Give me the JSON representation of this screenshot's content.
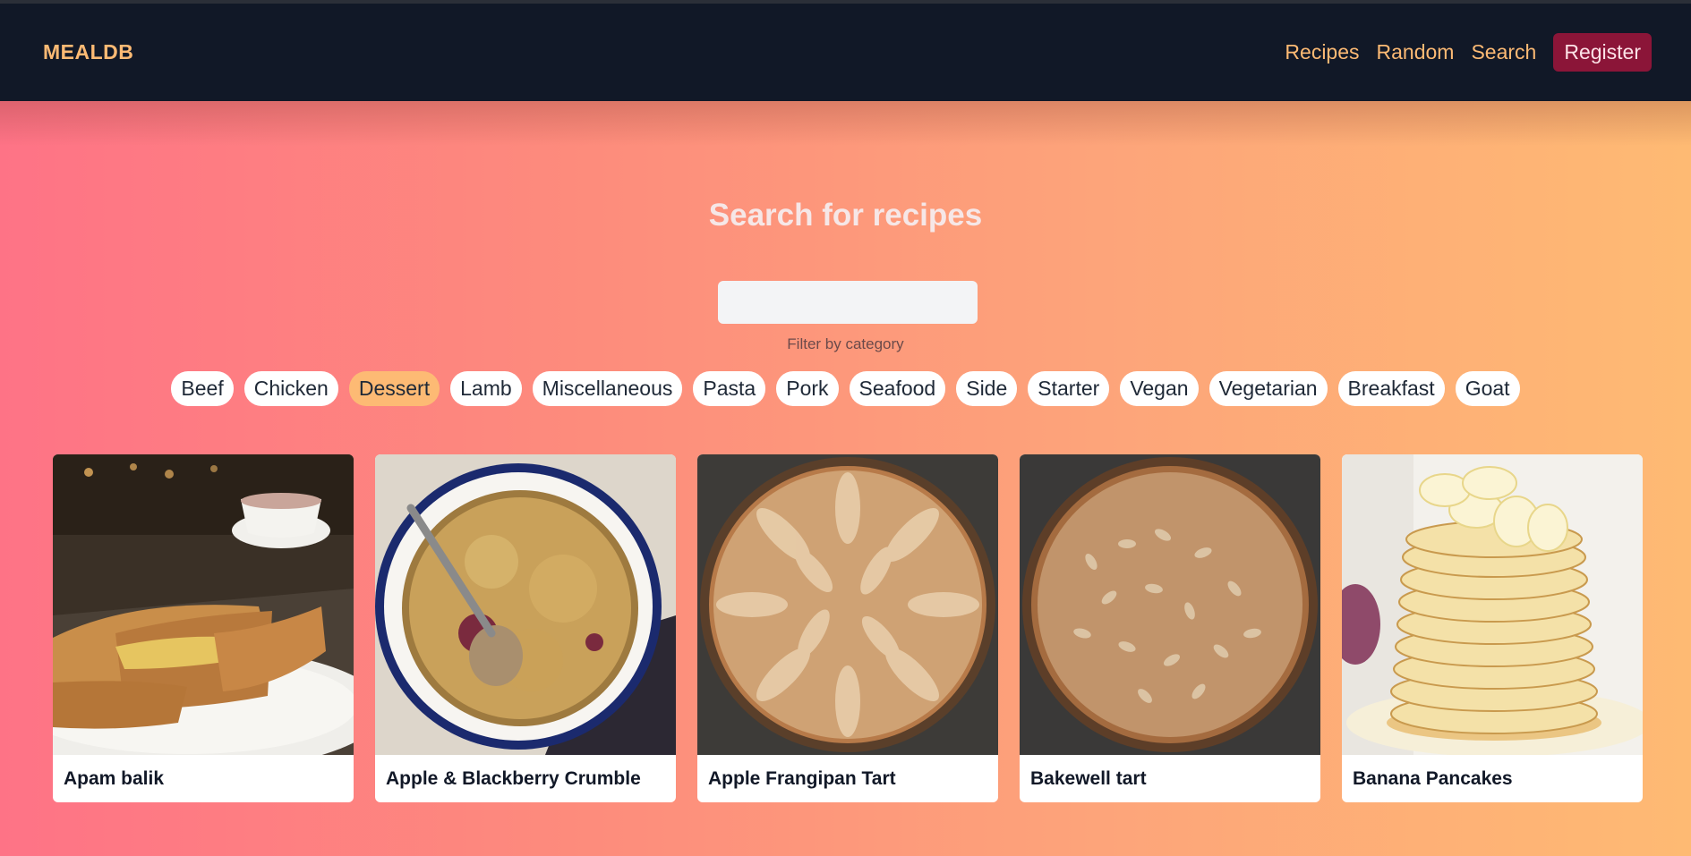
{
  "app": {
    "brand": "MEALDB"
  },
  "nav": {
    "links": [
      "Recipes",
      "Random",
      "Search"
    ],
    "register_label": "Register"
  },
  "search": {
    "title": "Search for recipes",
    "value": "",
    "placeholder": "",
    "filter_label": "Filter by category"
  },
  "categories": {
    "items": [
      "Beef",
      "Chicken",
      "Dessert",
      "Lamb",
      "Miscellaneous",
      "Pasta",
      "Pork",
      "Seafood",
      "Side",
      "Starter",
      "Vegan",
      "Vegetarian",
      "Breakfast",
      "Goat"
    ],
    "selected": "Dessert"
  },
  "recipes": [
    {
      "title": "Apam balik",
      "image": "apam-balik-photo"
    },
    {
      "title": "Apple & Blackberry Crumble",
      "image": "crumble-photo"
    },
    {
      "title": "Apple Frangipan Tart",
      "image": "frangipan-tart-photo"
    },
    {
      "title": "Bakewell tart",
      "image": "bakewell-tart-photo"
    },
    {
      "title": "Banana Pancakes",
      "image": "banana-pancakes-photo"
    }
  ],
  "colors": {
    "navbar_bg": "#111827",
    "accent": "#fdba74",
    "register_bg": "#8b1538",
    "gradient_start": "#fe7386",
    "gradient_end": "#feba73"
  }
}
